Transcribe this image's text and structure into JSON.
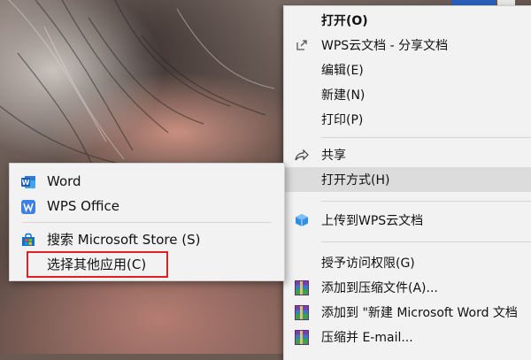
{
  "context_menu": {
    "items": [
      {
        "label": "打开(O)",
        "icon": "none",
        "bold": true
      },
      {
        "label": "WPS云文档 - 分享文档",
        "icon": "share-out-icon"
      },
      {
        "label": "编辑(E)",
        "icon": "none"
      },
      {
        "label": "新建(N)",
        "icon": "none"
      },
      {
        "label": "打印(P)",
        "icon": "none"
      },
      {
        "label": "共享",
        "icon": "share-icon"
      },
      {
        "label": "打开方式(H)",
        "icon": "none",
        "highlighted": true
      },
      {
        "label": "上传到WPS云文档",
        "icon": "cloud-cube-icon"
      },
      {
        "label": "授予访问权限(G)",
        "icon": "none"
      },
      {
        "label": "添加到压缩文件(A)...",
        "icon": "winrar-icon"
      },
      {
        "label": "添加到 \"新建 Microsoft Word 文档",
        "icon": "winrar-icon"
      },
      {
        "label": "压缩并 E-mail...",
        "icon": "winrar-icon"
      }
    ]
  },
  "open_with_submenu": {
    "items": [
      {
        "label": "Word",
        "icon": "word-icon"
      },
      {
        "label": "WPS Office",
        "icon": "wps-icon"
      },
      {
        "label": "搜索 Microsoft Store (S)",
        "icon": "store-icon"
      },
      {
        "label": "选择其他应用(C)",
        "icon": "none",
        "highlighted_by_annotation": true
      }
    ]
  },
  "colors": {
    "menu_bg": "#f2f2f2",
    "hover_bg": "#dcdcdc",
    "annotation_red": "#e02020",
    "word_blue": "#2b5fb8",
    "wps_blue": "#3f7fe0",
    "upload_blue": "#2f8fe0"
  }
}
